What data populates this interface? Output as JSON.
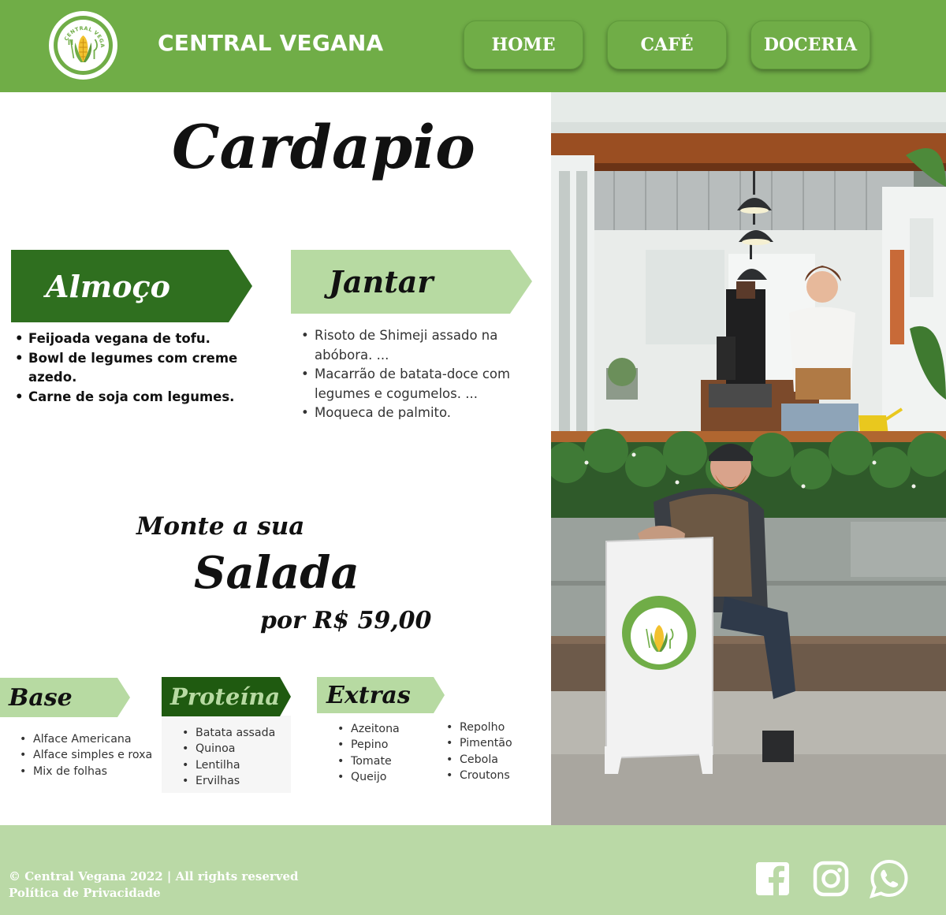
{
  "header": {
    "brand": "CENTRAL VEGANA",
    "logo_text": "CENTRAL VEGANA",
    "nav": [
      "HOME",
      "CAFÉ",
      "DOCERIA"
    ]
  },
  "menu": {
    "title": "Cardapio",
    "almoco": {
      "label": "Almoço",
      "items": [
        "Feijoada vegana de tofu.",
        "Bowl de legumes com creme azedo.",
        "Carne de soja com legumes."
      ]
    },
    "jantar": {
      "label": "Jantar",
      "items": [
        "Risoto de Shimeji assado na abóbora. ...",
        "Macarrão de batata-doce com legumes e cogumelos. ...",
        "Moqueca de palmito."
      ]
    }
  },
  "salad": {
    "line1": "Monte a sua",
    "line2": "Salada",
    "price": "por R$ 59,00",
    "base": {
      "label": "Base",
      "items": [
        "Alface Americana",
        "Alface simples e roxa",
        "Mix de folhas"
      ]
    },
    "proteina": {
      "label": "Proteína",
      "items": [
        "Batata assada",
        "Quinoa",
        "Lentilha",
        "Ervilhas"
      ]
    },
    "extras": {
      "label": "Extras",
      "items_col1": [
        "Azeitona",
        "Pepino",
        "Tomate",
        "Queijo"
      ],
      "items_col2": [
        "Repolho",
        "Pimentão",
        "Cebola",
        "Croutons"
      ]
    }
  },
  "photo": {
    "sign_text": "CENTRAL VEGANA"
  },
  "footer": {
    "copyright": "© Central Vegana 2022 | All rights reserved",
    "privacy": "Política de Privacidade",
    "social_icons": [
      "facebook-icon",
      "instagram-icon",
      "whatsapp-icon"
    ]
  },
  "colors": {
    "brand_green": "#70ad47",
    "dark_green": "#2f6f1f",
    "light_green": "#bad9a6",
    "ribbon_light": "#b7daa2"
  }
}
